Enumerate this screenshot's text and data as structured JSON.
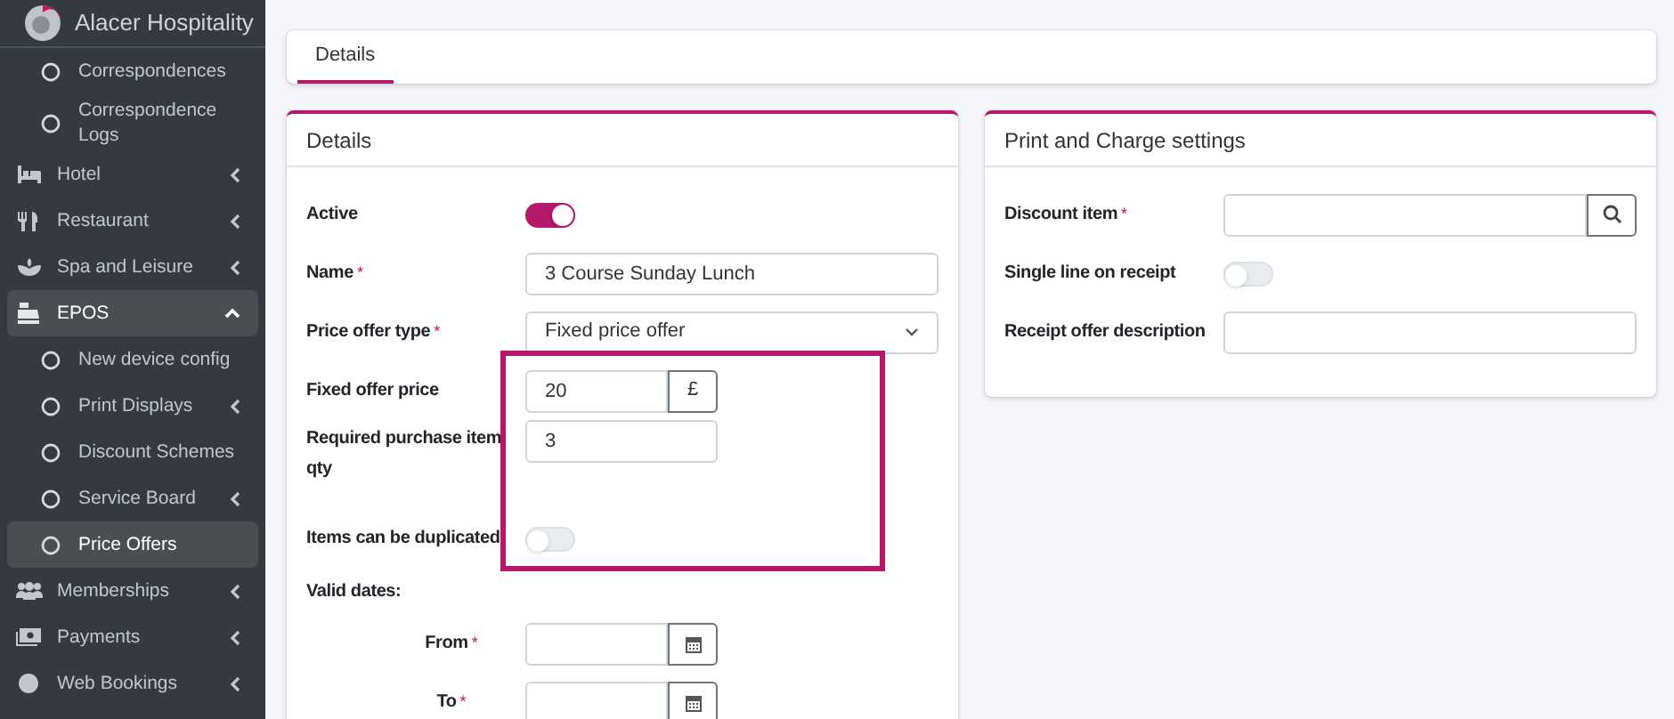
{
  "brand": {
    "name": "Alacer Hospitality"
  },
  "sidebar": {
    "items": [
      {
        "label": "Correspondences",
        "kind": "sub",
        "selected": false
      },
      {
        "label": "Correspondence Logs",
        "kind": "sub",
        "selected": false
      },
      {
        "label": "Hotel",
        "kind": "group",
        "expanded": false,
        "selected": false
      },
      {
        "label": "Restaurant",
        "kind": "group",
        "expanded": false,
        "selected": false
      },
      {
        "label": "Spa and Leisure",
        "kind": "group",
        "expanded": false,
        "selected": false
      },
      {
        "label": "EPOS",
        "kind": "group",
        "expanded": true,
        "selected": true,
        "children": [
          {
            "label": "New device config",
            "kind": "sub",
            "selected": false
          },
          {
            "label": "Print Displays",
            "kind": "sub",
            "expanded": false,
            "selected": false
          },
          {
            "label": "Discount Schemes",
            "kind": "sub",
            "selected": false
          },
          {
            "label": "Service Board",
            "kind": "sub",
            "expanded": false,
            "selected": false
          },
          {
            "label": "Price Offers",
            "kind": "sub",
            "selected": true
          }
        ]
      },
      {
        "label": "Memberships",
        "kind": "group",
        "expanded": false,
        "selected": false
      },
      {
        "label": "Payments",
        "kind": "group",
        "expanded": false,
        "selected": false
      },
      {
        "label": "Web Bookings",
        "kind": "group",
        "expanded": false,
        "selected": false
      }
    ]
  },
  "tabs": [
    {
      "label": "Details",
      "selected": true
    }
  ],
  "details": {
    "title": "Details",
    "fields": [
      {
        "kind": "toggle",
        "label": "Active",
        "on": true
      },
      {
        "kind": "text",
        "label": "Name",
        "marker": "*",
        "value": "3 Course Sunday Lunch"
      },
      {
        "kind": "select",
        "label": "Price offer type",
        "marker": "*",
        "value": "Fixed price offer"
      },
      {
        "kind": "addon",
        "label": "Fixed offer price",
        "value": "20",
        "addon": "£"
      },
      {
        "kind": "short",
        "label": "Required purchase item qty",
        "value": "3"
      },
      {
        "kind": "toggle",
        "label": "Items can be duplicated",
        "on": false
      },
      {
        "kind": "heading",
        "label": "Valid dates:"
      },
      {
        "kind": "date",
        "label": "From",
        "marker": "*"
      },
      {
        "kind": "date",
        "label": "To",
        "marker": "*"
      }
    ],
    "annotation": {
      "kind": "highlight-box"
    }
  },
  "print_settings": {
    "title": "Print and Charge settings",
    "fields": [
      {
        "kind": "search",
        "label": "Discount item",
        "marker": "*"
      },
      {
        "kind": "toggle",
        "label": "Single line on receipt",
        "on": false
      },
      {
        "kind": "text",
        "label": "Receipt offer description"
      }
    ]
  }
}
